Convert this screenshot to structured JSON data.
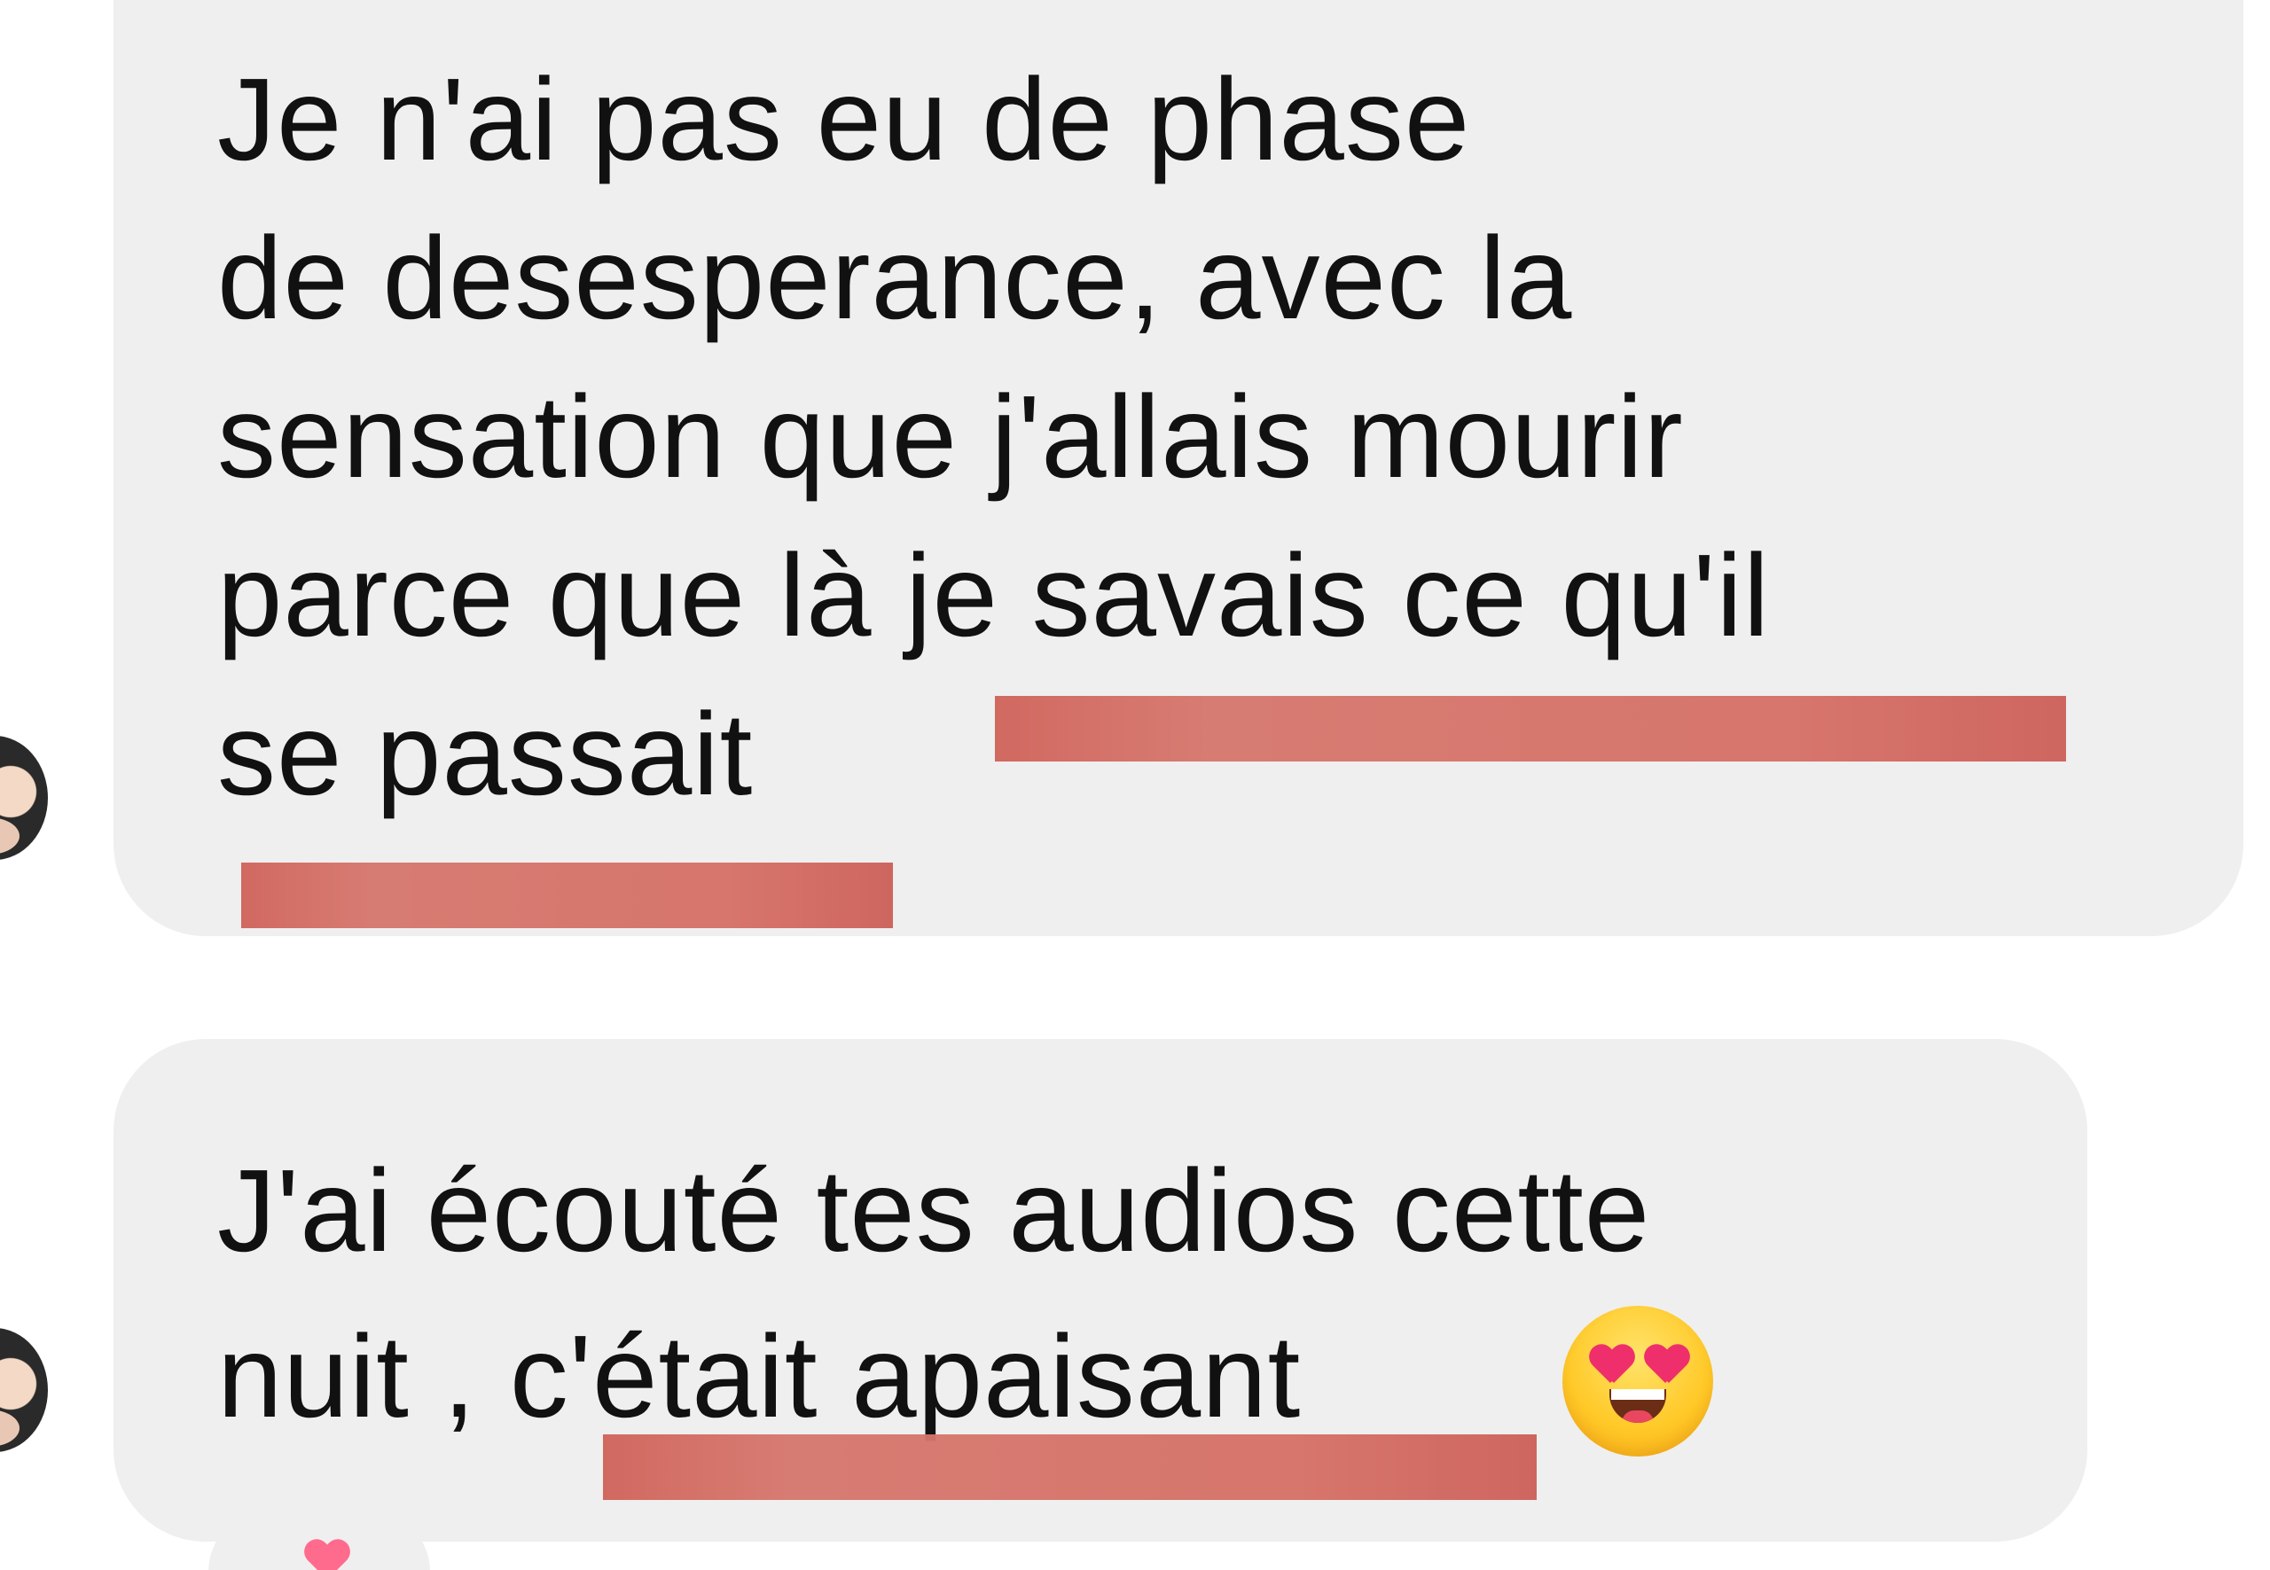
{
  "conversation": {
    "messages": [
      {
        "lines": [
          "Je n'ai pas eu de phase",
          "de desesperance, avec la",
          "sensation que j'allais mourir",
          "parce que là je savais ce qu'il",
          "se passait"
        ]
      },
      {
        "lines": [
          "J'ai écouté tes audios cette",
          "nuit , c'était apaisant"
        ],
        "emoji": "heart-eyes-emoji"
      }
    ],
    "reaction": "heart-reaction-icon"
  },
  "colors": {
    "bubble": "#efefef",
    "highlight": "#d56f65",
    "text": "#111111"
  }
}
